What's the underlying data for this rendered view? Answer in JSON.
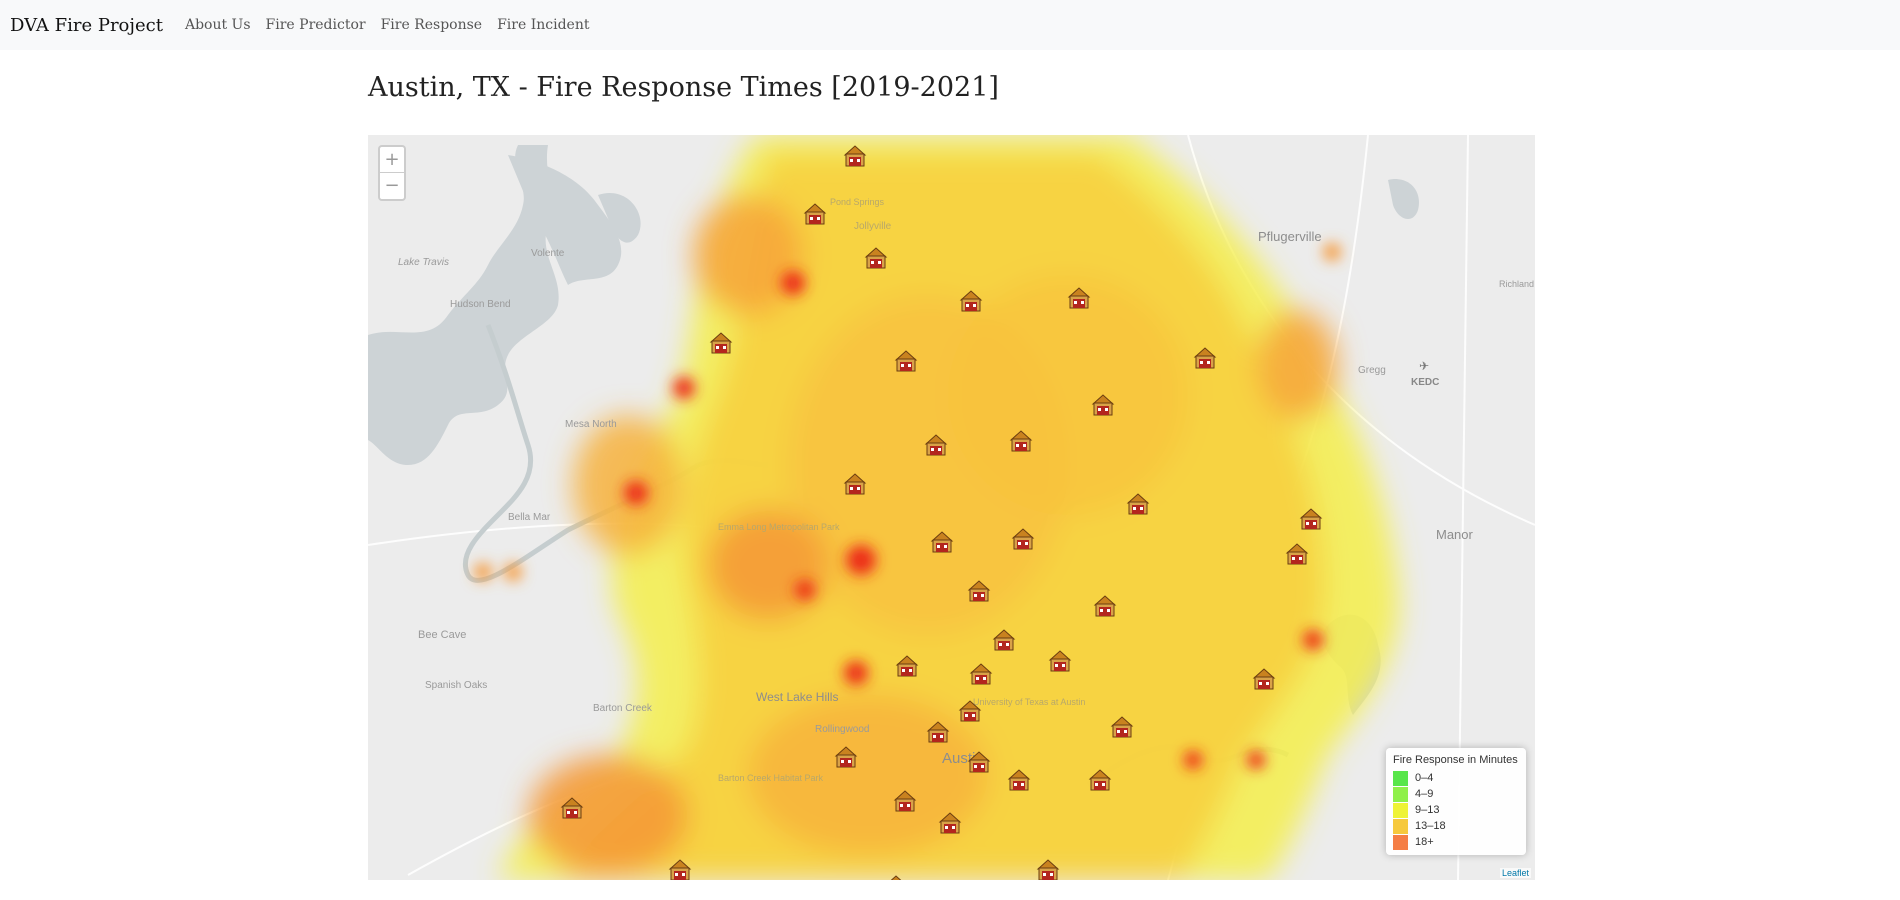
{
  "navbar": {
    "brand": "DVA Fire Project",
    "links": [
      "About Us",
      "Fire Predictor",
      "Fire Response",
      "Fire Incident"
    ]
  },
  "page": {
    "title": "Austin, TX - Fire Response Times [2019-2021]"
  },
  "map": {
    "zoom_in": "+",
    "zoom_out": "−",
    "attribution": "Leaflet",
    "place_labels": [
      "Pflugerville",
      "Lake Travis",
      "Volente",
      "Hudson Bend",
      "Mesa North",
      "Bella Mar",
      "Bee Cave",
      "Spanish Oaks",
      "Barton Creek",
      "West Lake Hills",
      "Rollingwood",
      "Austin",
      "Manor",
      "Gregg",
      "KEDC",
      "Jollyville",
      "Pond Springs",
      "Richland",
      "Emma Long Metropolitan Park",
      "University of Texas at Austin",
      "Barton Creek Habitat Park"
    ],
    "station_icon": "fire-station-icon",
    "heat_colors": {
      "low": "#6cf04a",
      "mid": "#f5f032",
      "high": "#fa9a28",
      "hot": "#ec2a17"
    }
  },
  "legend": {
    "title": "Fire Response in Minutes",
    "items": [
      {
        "label": "0–4",
        "color": "#58e64a"
      },
      {
        "label": "4–9",
        "color": "#8ff04a"
      },
      {
        "label": "9–13",
        "color": "#eef336"
      },
      {
        "label": "13–18",
        "color": "#f6c93d"
      },
      {
        "label": "18+",
        "color": "#f57e45"
      }
    ]
  }
}
